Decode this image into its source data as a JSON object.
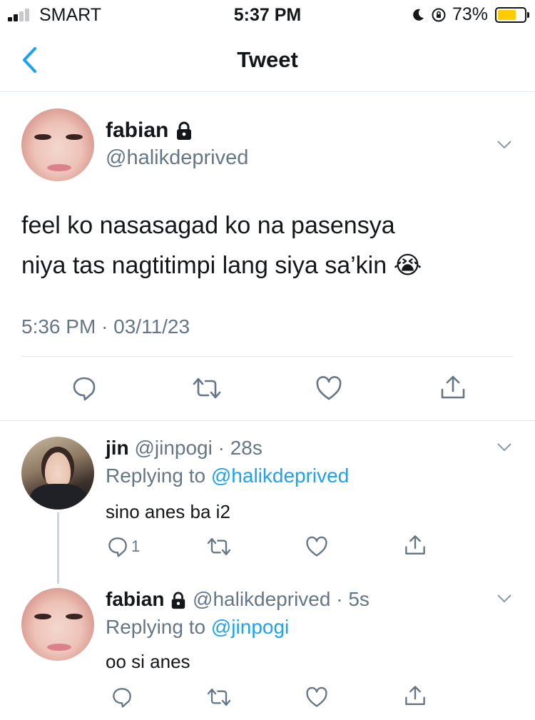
{
  "status_bar": {
    "carrier": "SMART",
    "time": "5:37 PM",
    "battery_percent": "73%",
    "battery_level": 0.73,
    "signal_bars": 2
  },
  "nav": {
    "title": "Tweet",
    "back_icon": "chevron-left-icon"
  },
  "tweet": {
    "author_name": "fabian",
    "author_handle": "@halikdeprived",
    "text_line1": "feel ko nasasagad ko na pasensya",
    "text_line2": "niya tas nagtitimpi lang siya sa’kin",
    "emoji": "😭",
    "timestamp": "5:36 PM · 03/11/23"
  },
  "replies": [
    {
      "author_name": "jin",
      "author_handle": "@jinpogi",
      "age": "· 28s",
      "replying_label": "Replying to",
      "replying_to": "@halikdeprived",
      "text": "sino anes ba i2",
      "reply_count": "1"
    },
    {
      "author_name": "fabian",
      "author_handle": "@halikdeprived",
      "age": "· 5s",
      "replying_label": "Replying to",
      "replying_to": "@jinpogi",
      "text": "oo si anes",
      "reply_count": ""
    }
  ],
  "colors": {
    "accent": "#1da1f2",
    "muted": "#657786",
    "divider": "#e1e8ed"
  },
  "icons": [
    "reply-icon",
    "retweet-icon",
    "like-icon",
    "share-icon",
    "lock-icon",
    "chevron-down-icon"
  ]
}
